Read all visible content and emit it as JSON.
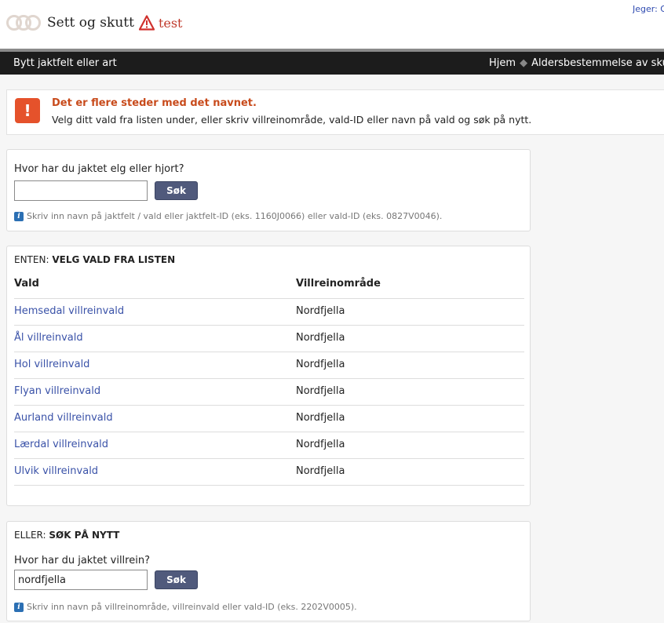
{
  "header": {
    "brand": "Sett og skutt",
    "env": "test",
    "user": "Jeger: Oslo"
  },
  "nav": {
    "left": "Bytt jaktfelt eller art",
    "right_items": [
      "Hjem",
      "Aldersbestemmelse av sku"
    ]
  },
  "alert": {
    "title": "Det er flere steder med det navnet.",
    "text": "Velg ditt vald fra listen under, eller skriv villreinområde, vald-ID eller navn på vald og søk på nytt."
  },
  "search1": {
    "label": "Hvor har du jaktet elg eller hjort?",
    "value": "",
    "button": "Søk",
    "hint": "Skriv inn navn på jaktfelt / vald eller jaktfelt-ID (eks. 1160J0066) eller vald-ID (eks. 0827V0046)."
  },
  "list": {
    "title_prefix": "ENTEN:",
    "title": "VELG VALD FRA LISTEN",
    "col_vald": "Vald",
    "col_omrade": "Villreinområde",
    "rows": [
      {
        "vald": "Hemsedal villreinvald",
        "omrade": "Nordfjella"
      },
      {
        "vald": "Ål villreinvald",
        "omrade": "Nordfjella"
      },
      {
        "vald": "Hol villreinvald",
        "omrade": "Nordfjella"
      },
      {
        "vald": "Flyan villreinvald",
        "omrade": "Nordfjella"
      },
      {
        "vald": "Aurland villreinvald",
        "omrade": "Nordfjella"
      },
      {
        "vald": "Lærdal villreinvald",
        "omrade": "Nordfjella"
      },
      {
        "vald": "Ulvik villreinvald",
        "omrade": "Nordfjella"
      }
    ]
  },
  "search2": {
    "title_prefix": "ELLER:",
    "title": "SØK PÅ NYTT",
    "label": "Hvor har du jaktet villrein?",
    "value": "nordfjella",
    "button": "Søk",
    "hint": "Skriv inn navn på villreinområde, villreinvald eller vald-ID (eks. 2202V0005)."
  },
  "colors": {
    "navbar": "#1c1c1c",
    "alert_title": "#c84b1c",
    "alert_icon": "#e5522b",
    "link": "#3a52a8",
    "button": "#505a7c"
  }
}
